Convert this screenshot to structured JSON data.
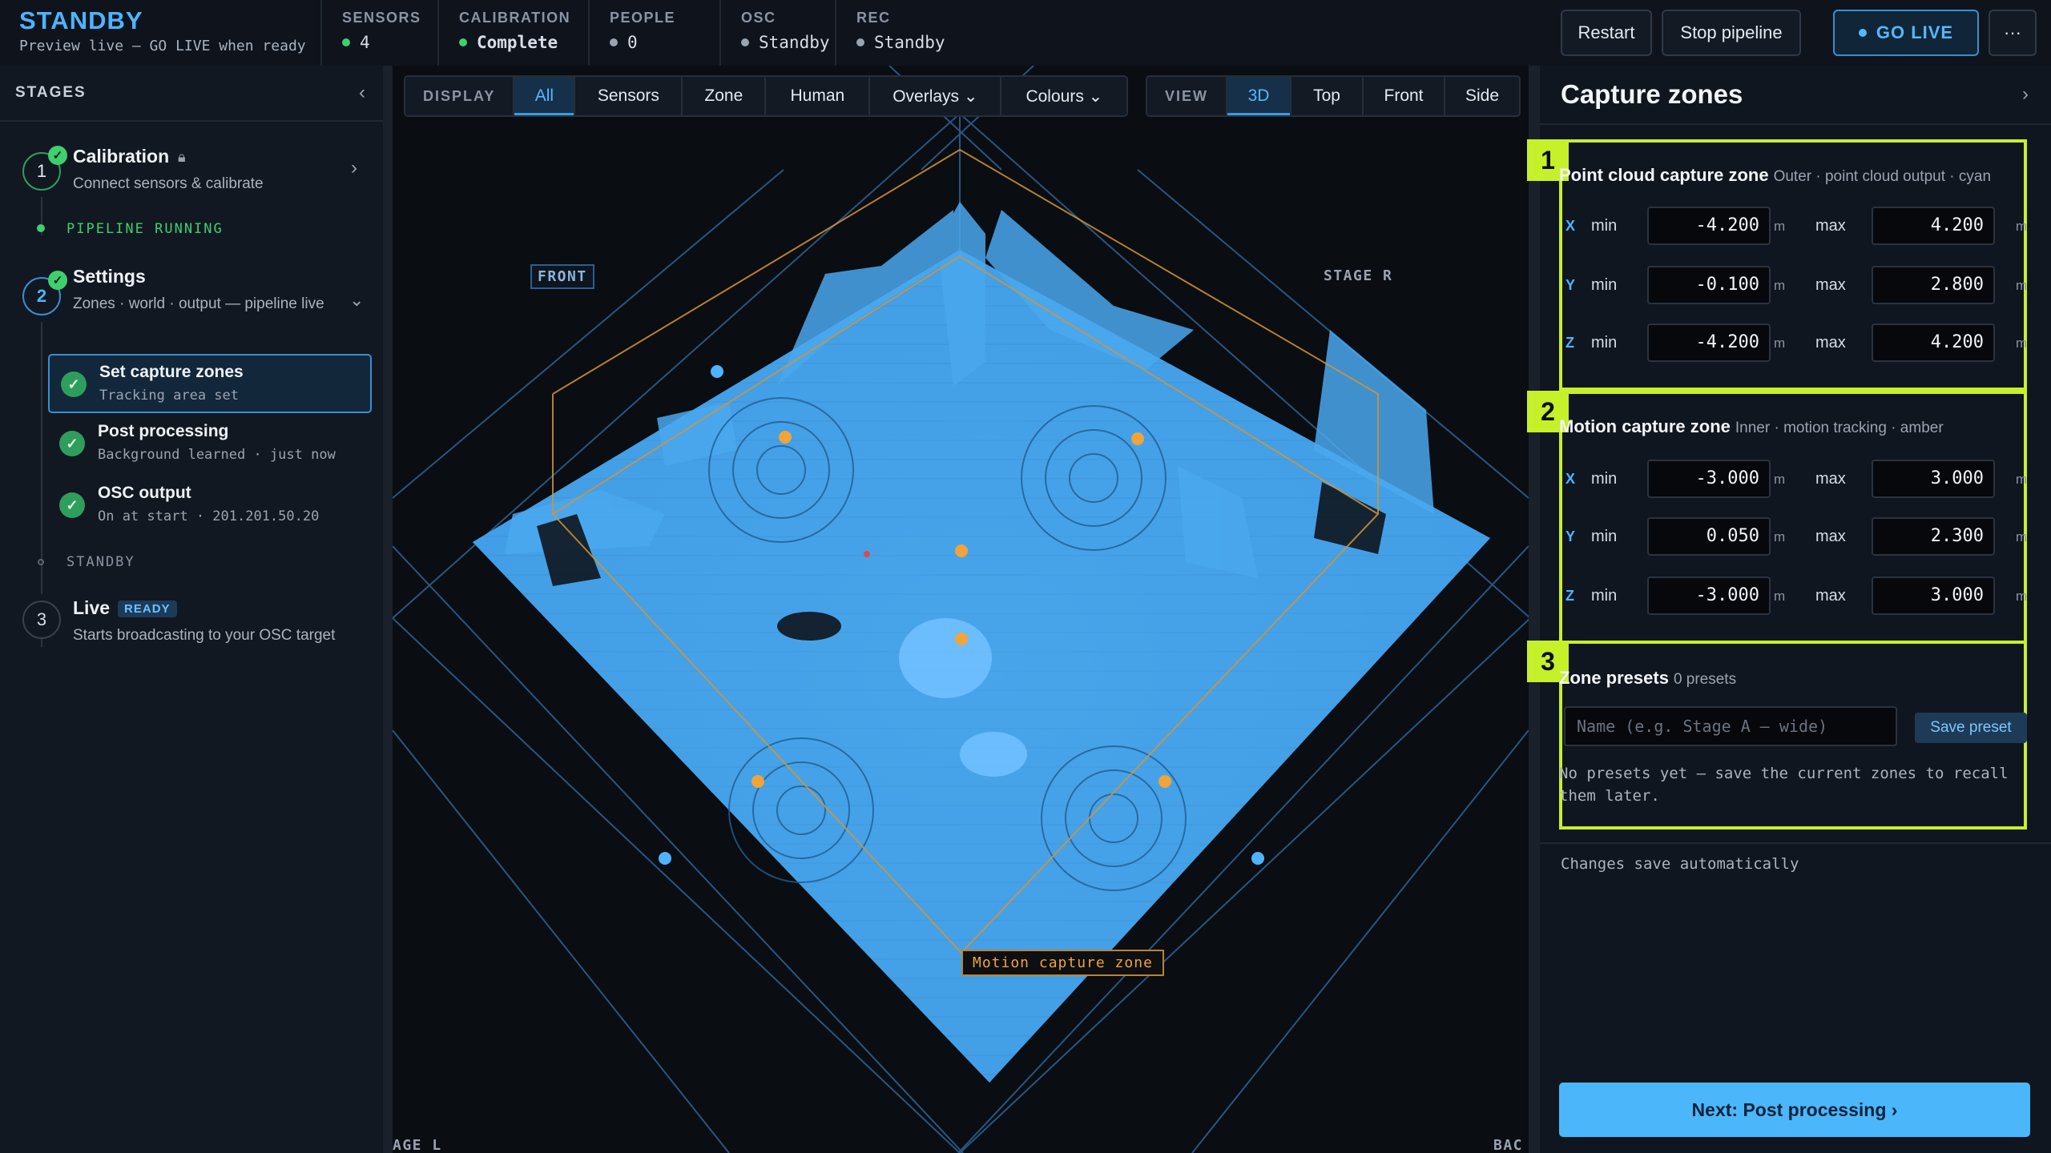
{
  "brand": {
    "title": "STANDBY",
    "subtitle": "Preview live — GO LIVE when ready"
  },
  "status": {
    "sensors": {
      "label": "SENSORS",
      "value": "4"
    },
    "calibration": {
      "label": "CALIBRATION",
      "value": "Complete"
    },
    "people": {
      "label": "PEOPLE",
      "value": "0"
    },
    "osc": {
      "label": "OSC",
      "value": "Standby"
    },
    "rec": {
      "label": "REC",
      "value": "Standby"
    }
  },
  "toolbar": {
    "restart": "Restart",
    "stop": "Stop pipeline",
    "golive": "GO LIVE",
    "more": "···"
  },
  "sidebar": {
    "heading": "STAGES",
    "steps": [
      {
        "num": "1",
        "title": "Calibration",
        "subtitle": "Connect sensors & calibrate"
      },
      {
        "num": "2",
        "title": "Settings",
        "subtitle": "Zones · world · output — pipeline live"
      },
      {
        "num": "3",
        "title": "Live",
        "badge": "READY",
        "subtitle": "Starts broadcasting to your OSC target"
      }
    ],
    "phase_running": "PIPELINE RUNNING",
    "phase_standby": "STANDBY",
    "sub_items": [
      {
        "title": "Set capture zones",
        "subtitle": "Tracking area set"
      },
      {
        "title": "Post processing",
        "subtitle": "Background learned · just now"
      },
      {
        "title": "OSC output",
        "subtitle": "On at start · 201.201.50.20"
      }
    ]
  },
  "viewport": {
    "display_label": "DISPLAY",
    "display_options": [
      "All",
      "Sensors",
      "Zone",
      "Human",
      "Overlays ⌄",
      "Colours ⌄"
    ],
    "display_selected": "All",
    "view_label": "VIEW",
    "view_options": [
      "3D",
      "Top",
      "Front",
      "Side"
    ],
    "view_selected": "3D",
    "labels": {
      "front": "FRONT",
      "stage_r": "STAGE R",
      "stage_l": "AGE L",
      "back": "BAC",
      "motion_zone": "Motion capture zone"
    }
  },
  "panel": {
    "title": "Capture zones",
    "zones": [
      {
        "num": "1",
        "title": "Point cloud capture zone",
        "note": "Outer · point cloud output · cyan",
        "axes": [
          {
            "axis": "X",
            "min": "-4.200",
            "max": "4.200"
          },
          {
            "axis": "Y",
            "min": "-0.100",
            "max": "2.800"
          },
          {
            "axis": "Z",
            "min": "-4.200",
            "max": "4.200"
          }
        ]
      },
      {
        "num": "2",
        "title": "Motion capture zone",
        "note": "Inner · motion tracking · amber",
        "axes": [
          {
            "axis": "X",
            "min": "-3.000",
            "max": "3.000"
          },
          {
            "axis": "Y",
            "min": "0.050",
            "max": "2.300"
          },
          {
            "axis": "Z",
            "min": "-3.000",
            "max": "3.000"
          }
        ]
      }
    ],
    "min_label": "min",
    "max_label": "max",
    "unit": "m",
    "presets": {
      "num": "3",
      "title": "Zone presets",
      "count": "0 presets",
      "placeholder": "Name (e.g. Stage A — wide)",
      "save": "Save preset",
      "empty": "No presets yet — save the current zones to recall them later."
    },
    "autosave": "Changes save automatically",
    "next": "Next: Post processing ›"
  },
  "colors": {
    "accent": "#4fb3ff",
    "highlight": "#c6f02a",
    "ok": "#3fcf6e",
    "cloud": "#4aa8ee",
    "amber": "#f0a43a"
  }
}
